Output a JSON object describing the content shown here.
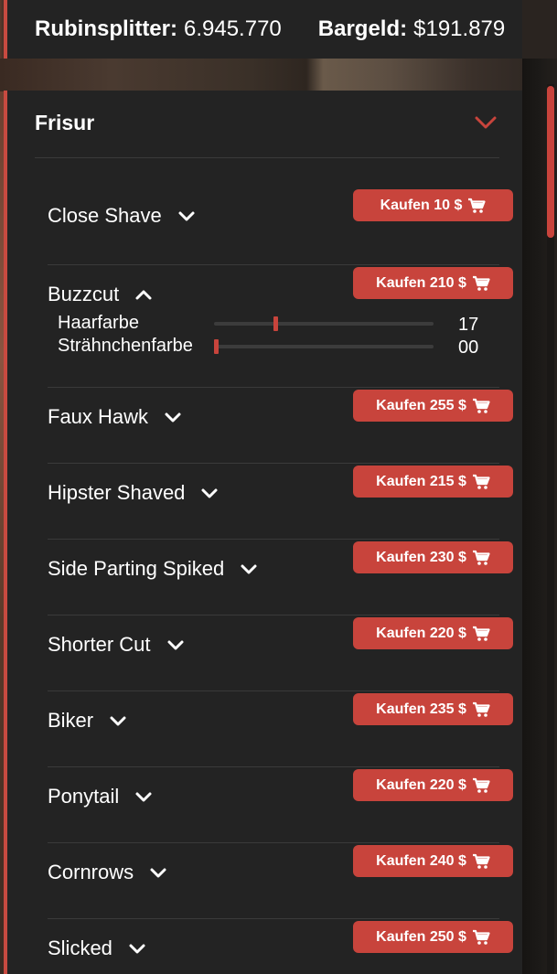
{
  "money": {
    "ruby_label": "Rubinsplitter:",
    "ruby_value": "6.945.770",
    "cash_label": "Bargeld:",
    "cash_value": "$191.879"
  },
  "panel": {
    "title": "Frisur",
    "expanded": true
  },
  "accent_color": "#c8443c",
  "items": [
    {
      "name": "Close Shave",
      "buy_label": "Kaufen 10 $",
      "expanded": false
    },
    {
      "name": "Buzzcut",
      "buy_label": "Kaufen 210 $",
      "expanded": true,
      "options": [
        {
          "label": "Haarfarbe",
          "value": "17",
          "fraction": 0.27
        },
        {
          "label": "Strähnchenfarbe",
          "value": "00",
          "fraction": 0.0
        }
      ]
    },
    {
      "name": "Faux Hawk",
      "buy_label": "Kaufen 255 $",
      "expanded": false
    },
    {
      "name": "Hipster Shaved",
      "buy_label": "Kaufen 215 $",
      "expanded": false
    },
    {
      "name": "Side Parting Spiked",
      "buy_label": "Kaufen 230 $",
      "expanded": false
    },
    {
      "name": "Shorter Cut",
      "buy_label": "Kaufen 220 $",
      "expanded": false
    },
    {
      "name": "Biker",
      "buy_label": "Kaufen 235 $",
      "expanded": false
    },
    {
      "name": "Ponytail",
      "buy_label": "Kaufen 220 $",
      "expanded": false
    },
    {
      "name": "Cornrows",
      "buy_label": "Kaufen 240 $",
      "expanded": false
    },
    {
      "name": "Slicked",
      "buy_label": "Kaufen 250 $",
      "expanded": false
    }
  ]
}
